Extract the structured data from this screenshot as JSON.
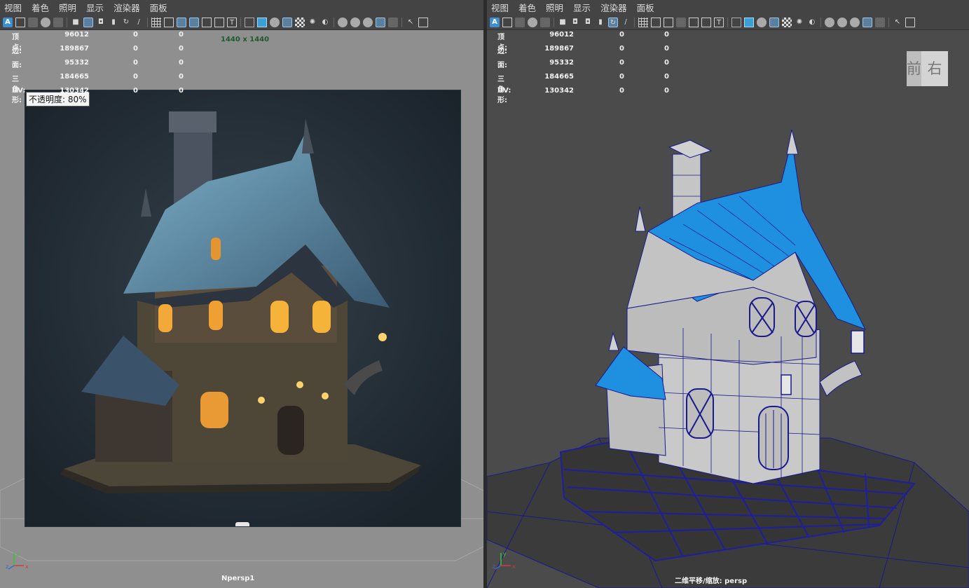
{
  "menus": [
    "视图",
    "着色",
    "照明",
    "显示",
    "渲染器",
    "面板"
  ],
  "toolbar_icons": [
    "select-camera-icon",
    "camera-attr-icon",
    "bookmark-icon",
    "image-plane-icon",
    "grid-icon",
    "film-gate-icon",
    "resolution-gate-icon",
    "gate-mask-icon",
    "field-chart-icon",
    "safe-action-icon",
    "safe-title-icon",
    "wireframe-icon",
    "smooth-shade-icon",
    "wireframe-on-shaded-icon",
    "textured-icon",
    "lights-icon",
    "shadows-icon",
    "isolate-icon",
    "xray-icon",
    "xray-joints-icon",
    "ssao-icon",
    "motion-blur-icon",
    "multisample-icon",
    "depth-of-field-icon",
    "snap-view-icon",
    "panel-layout-icon"
  ],
  "stats": {
    "labels": [
      "顶点:",
      "边:",
      "面:",
      "三角形:",
      "UV:"
    ],
    "left_rows": [
      {
        "label": "顶点:",
        "v1": "96012",
        "v2": "0",
        "v3": "0"
      },
      {
        "label": "边:",
        "v1": "189867",
        "v2": "0",
        "v3": "0"
      },
      {
        "label": "面:",
        "v1": "95332",
        "v2": "0",
        "v3": "0"
      },
      {
        "label": "三角形:",
        "v1": "184665",
        "v2": "0",
        "v3": "0"
      },
      {
        "label": "UV:",
        "v1": "130342",
        "v2": "0",
        "v3": "0"
      }
    ],
    "right_rows": [
      {
        "label": "顶点:",
        "v1": "96012",
        "v2": "0",
        "v3": "0"
      },
      {
        "label": "边:",
        "v1": "189867",
        "v2": "0",
        "v3": "0"
      },
      {
        "label": "面:",
        "v1": "95332",
        "v2": "0",
        "v3": "0"
      },
      {
        "label": "三角形:",
        "v1": "184665",
        "v2": "0",
        "v3": "0"
      },
      {
        "label": "UV:",
        "v1": "130342",
        "v2": "0",
        "v3": "0"
      }
    ]
  },
  "left_viewport": {
    "resolution": "1440 x 1440",
    "opacity_tooltip": "不透明度: 80%",
    "camera": "Npersp1",
    "background": "#8f8f8f"
  },
  "right_viewport": {
    "camera": "二维平移/缩放: persp",
    "viewcube": {
      "front": "前",
      "right": "右"
    },
    "background": "#4b4b4b",
    "wire_color": "#1a1a8c",
    "roof_color": "#1f8fe0"
  },
  "axis_labels": {
    "y": "y",
    "z": "z",
    "x": "x"
  }
}
